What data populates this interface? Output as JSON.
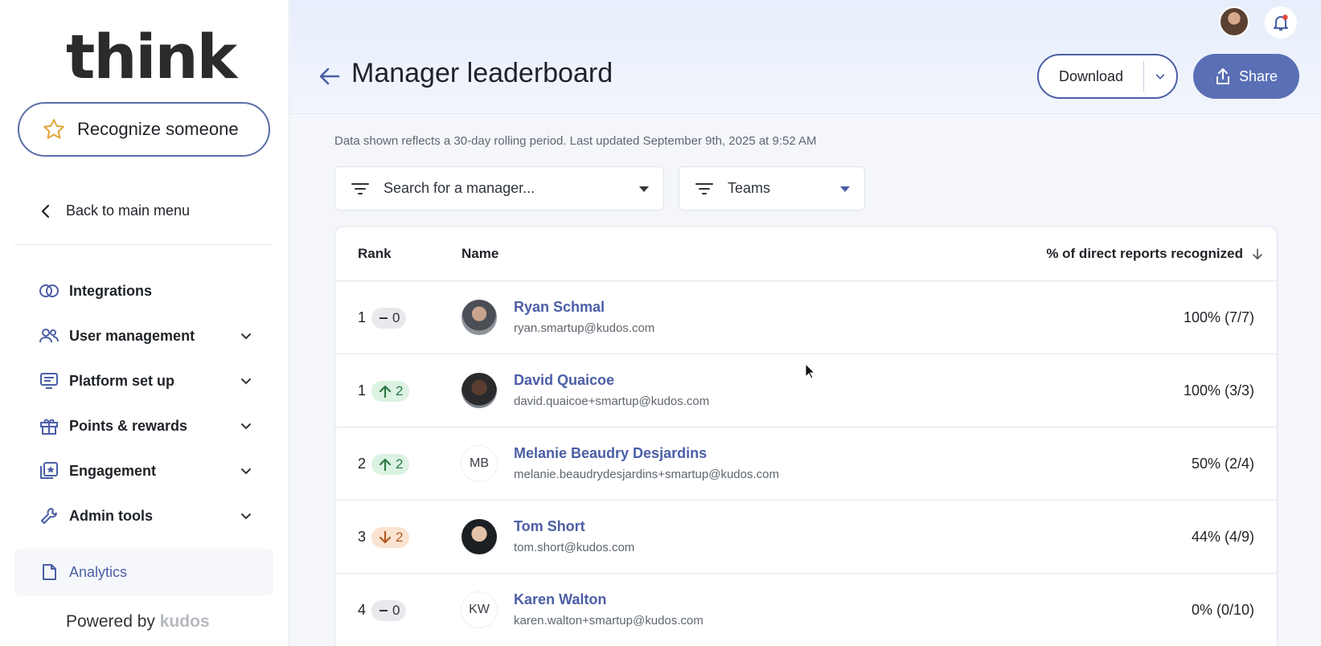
{
  "brand": {
    "logo": "think"
  },
  "sidebar": {
    "recognize_label": "Recognize someone",
    "back_label": "Back to main menu",
    "items": [
      {
        "label": "Integrations",
        "icon": "rings-icon",
        "expandable": false
      },
      {
        "label": "User management",
        "icon": "users-icon",
        "expandable": true
      },
      {
        "label": "Platform set up",
        "icon": "monitor-icon",
        "expandable": true
      },
      {
        "label": "Points & rewards",
        "icon": "gift-icon",
        "expandable": true
      },
      {
        "label": "Engagement",
        "icon": "star-card-icon",
        "expandable": true
      },
      {
        "label": "Admin tools",
        "icon": "wrench-icon",
        "expandable": true
      },
      {
        "label": "Analytics",
        "icon": "document-icon",
        "expandable": false,
        "active": true
      }
    ],
    "powered_prefix": "Powered by",
    "powered_brand": "kudos"
  },
  "header": {
    "title": "Manager leaderboard",
    "download_label": "Download",
    "share_label": "Share"
  },
  "notice": "Data shown reflects a 30-day rolling period. Last updated September 9th, 2025 at 9:52 AM",
  "filters": {
    "manager_placeholder": "Search for a manager...",
    "teams_label": "Teams"
  },
  "table": {
    "columns": {
      "rank": "Rank",
      "name": "Name",
      "pct": "% of direct reports recognized"
    },
    "rows": [
      {
        "rank": "1",
        "change": "0",
        "trend": "neutral",
        "avatar": "photo",
        "initials": "",
        "name": "Ryan Schmal",
        "email": "ryan.smartup@kudos.com",
        "pct": "100% (7/7)"
      },
      {
        "rank": "1",
        "change": "2",
        "trend": "up",
        "avatar": "photo",
        "initials": "",
        "name": "David Quaicoe",
        "email": "david.quaicoe+smartup@kudos.com",
        "pct": "100% (3/3)"
      },
      {
        "rank": "2",
        "change": "2",
        "trend": "up",
        "avatar": "initials",
        "initials": "MB",
        "name": "Melanie Beaudry Desjardins",
        "email": "melanie.beaudrydesjardins+smartup@kudos.com",
        "pct": "50% (2/4)"
      },
      {
        "rank": "3",
        "change": "2",
        "trend": "down",
        "avatar": "photo",
        "initials": "",
        "name": "Tom Short",
        "email": "tom.short@kudos.com",
        "pct": "44% (4/9)"
      },
      {
        "rank": "4",
        "change": "0",
        "trend": "neutral",
        "avatar": "initials",
        "initials": "KW",
        "name": "Karen Walton",
        "email": "karen.walton+smartup@kudos.com",
        "pct": "0% (0/10)"
      }
    ]
  },
  "colors": {
    "accent": "#4b5ea6",
    "share_bg": "#5a6fb5",
    "up": "#2c7a43",
    "down": "#b35a20"
  }
}
